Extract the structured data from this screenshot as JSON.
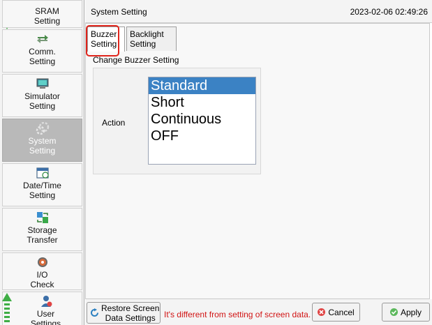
{
  "sidebar": {
    "items": [
      {
        "label": "SRAM\nSetting",
        "icon": "sram-icon"
      },
      {
        "label": "Comm.\nSetting",
        "icon": "comm-icon"
      },
      {
        "label": "Simulator\nSetting",
        "icon": "simulator-icon"
      },
      {
        "label": "System\nSetting",
        "icon": "gear-icon",
        "selected": true
      },
      {
        "label": "Date/Time\nSetting",
        "icon": "calendar-icon"
      },
      {
        "label": "Storage\nTransfer",
        "icon": "storage-transfer-icon"
      },
      {
        "label": "I/O\nCheck",
        "icon": "io-check-icon"
      },
      {
        "label": "User\nSettings",
        "icon": "user-settings-icon"
      }
    ]
  },
  "header": {
    "title": "System Setting",
    "datetime": "2023-02-06 02:49:26"
  },
  "tabs": [
    {
      "label": "Buzzer\nSetting",
      "active": true
    },
    {
      "label": "Backlight\nSetting",
      "active": false
    }
  ],
  "section": {
    "title": "Change Buzzer Setting",
    "action_label": "Action",
    "options": [
      "Standard",
      "Short",
      "Continuous",
      "OFF"
    ],
    "selected": "Standard"
  },
  "footer": {
    "restore_label": "Restore Screen\nData Settings",
    "warning": "It's different from setting of screen data.",
    "cancel_label": "Cancel",
    "apply_label": "Apply"
  },
  "colors": {
    "highlight": "#e0241b",
    "selection": "#3b82c4",
    "warning": "#d11414",
    "cancel": "#e04444",
    "apply": "#5cb85c"
  }
}
